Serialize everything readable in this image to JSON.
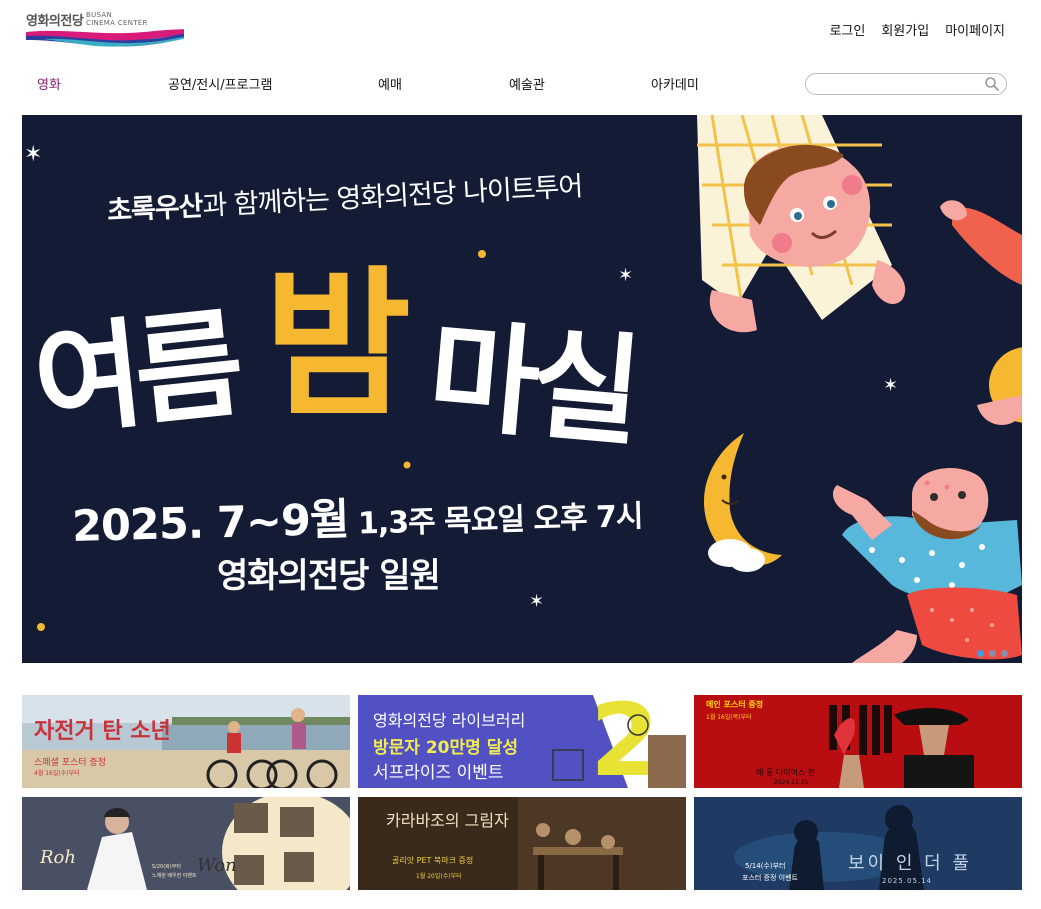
{
  "logo": {
    "ko": "영화의전당",
    "en_line1": "BUSAN",
    "en_line2": "CINEMA CENTER"
  },
  "util_nav": [
    "로그인",
    "회원가입",
    "마이페이지"
  ],
  "gnb": [
    {
      "label": "영화",
      "active": true
    },
    {
      "label": "공연/전시/프로그램",
      "active": false
    },
    {
      "label": "예매",
      "active": false
    },
    {
      "label": "예술관",
      "active": false
    },
    {
      "label": "아카데미",
      "active": false
    }
  ],
  "search": {
    "value": "",
    "icon": "search-icon"
  },
  "hero": {
    "subtitle_bold": "초록우산",
    "subtitle_rest": "과 함께하는 영화의전당 나이트투어",
    "title_1": "여름",
    "title_2": "밤",
    "title_3": "마실",
    "date_big": "2025. 7~9월",
    "date_small": " 1,3주 목요일 오후 7시",
    "host": "영화의전당 일원",
    "colors": {
      "bg": "#141b35",
      "accent": "#f6b731"
    },
    "slide_count": 3,
    "active_slide": 1
  },
  "thumbnails": [
    {
      "title": "자전거 탄 소년",
      "line1": "스페셜 포스터 증정",
      "line2": "4월 16일(수)부터"
    },
    {
      "line1": "영화의전당 라이브러리",
      "line2": "방문자 20만명 달성",
      "line3": "서프라이즈 이벤트"
    },
    {
      "line1": "메인 포스터 증정",
      "line2": "1월 16일(목)부터",
      "line3": "애 통  다이어스 전",
      "line4": "2024.12.25"
    },
    {
      "line1": "Roh",
      "line2": "Won",
      "line3": "5/20(화)부터",
      "line4": "노재원 배우전 이벤트"
    },
    {
      "line1": "카라바조의 그림자",
      "line2": "골리앗 PET 북마크 증정",
      "line3": "1월 20일(수)부터"
    },
    {
      "line1": "보이 인 더 풀",
      "line2": "5/14(수)부터",
      "line3": "포스터 증정 이벤트",
      "line4": "2025.05.14"
    }
  ]
}
